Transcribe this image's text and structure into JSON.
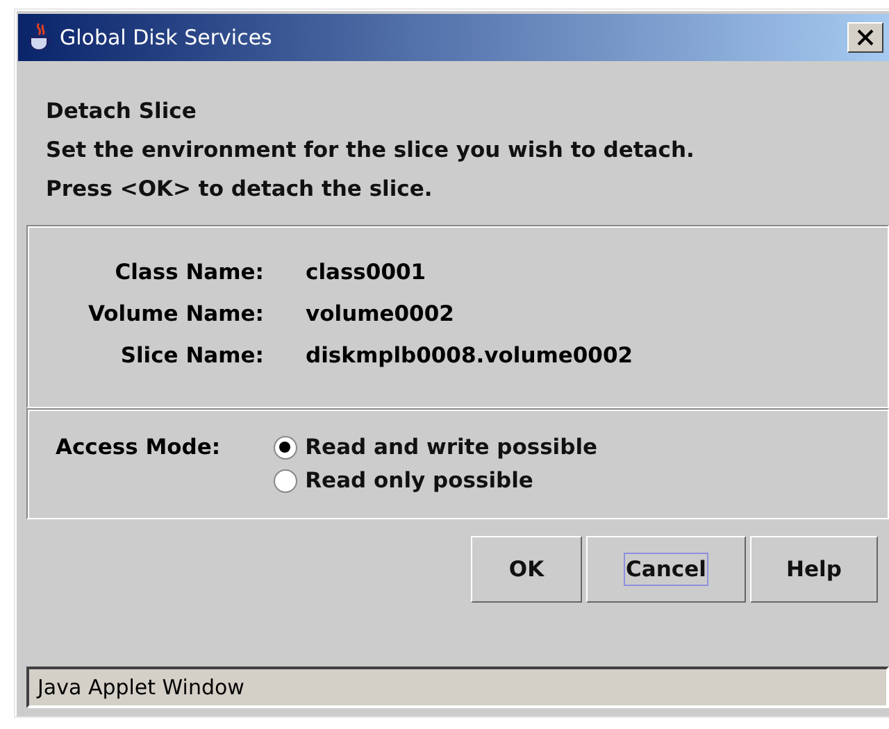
{
  "window": {
    "title": "Global Disk Services"
  },
  "heading": "Detach Slice",
  "instructions": [
    "Set the environment for the slice you wish to detach.",
    "Press <OK> to detach the slice."
  ],
  "info": [
    {
      "label": "Class Name:",
      "value": "class0001"
    },
    {
      "label": "Volume Name:",
      "value": "volume0002"
    },
    {
      "label": "Slice Name:",
      "value": "diskmplb0008.volume0002"
    }
  ],
  "access_mode": {
    "label": "Access Mode:",
    "options": [
      {
        "label": "Read and write possible",
        "selected": true
      },
      {
        "label": "Read only possible",
        "selected": false
      }
    ]
  },
  "buttons": [
    {
      "label": "OK",
      "focused": false
    },
    {
      "label": "Cancel",
      "focused": true
    },
    {
      "label": "Help",
      "focused": false
    }
  ],
  "status_bar": "Java Applet Window"
}
